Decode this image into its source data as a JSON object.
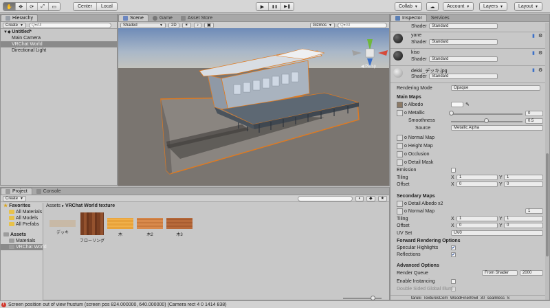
{
  "toolbar": {
    "tools": [
      "✋",
      "✥",
      "⟳",
      "⤢",
      "▭"
    ],
    "pivot_label": "Center",
    "space_label": "Local",
    "play_icons": [
      "▶",
      "❚❚",
      "▶❚"
    ],
    "collab_label": "Collab",
    "account_label": "Account",
    "layers_label": "Layers",
    "layout_label": "Layout",
    "cloud_icon": "☁"
  },
  "hierarchy": {
    "tab": "Hierarchy",
    "create": "Create",
    "search_placeholder": "Q▾All",
    "scene": "Untitled*",
    "items": [
      "Main Camera",
      "VRChat World",
      "Directional Light"
    ]
  },
  "scene": {
    "tabs": [
      "Scene",
      "Game",
      "Asset Store"
    ],
    "shading": "Shaded",
    "mode_2d": "2D",
    "gizmos": "Gizmos",
    "search_placeholder": "Q▾All",
    "persp": "◀ Persp"
  },
  "project": {
    "tabs": [
      "Project",
      "Console"
    ],
    "create": "Create",
    "favorites_label": "Favorites",
    "favorites": [
      "All Materials",
      "All Models",
      "All Prefabs"
    ],
    "assets_label": "Assets",
    "folders": [
      "Materials",
      "VRChat World"
    ],
    "breadcrumb_root": "Assets",
    "breadcrumb_sep": "▸",
    "breadcrumb_leaf": "VRChat World texture",
    "assets": [
      {
        "label": "デッキ",
        "color": "#c8b9a6"
      },
      {
        "label": "フローリング",
        "color": "#8b4a2a"
      },
      {
        "label": "木",
        "color": "#e8a23a"
      },
      {
        "label": "木2",
        "color": "#d98a4c"
      },
      {
        "label": "木3",
        "color": "#b86a3a"
      }
    ]
  },
  "inspector": {
    "tabs": [
      "Inspector",
      "Services"
    ],
    "materials": [
      {
        "name": "yane",
        "shader_label": "Shader",
        "shader": "Standard"
      },
      {
        "name": "kiso",
        "shader_label": "Shader",
        "shader": "Standard"
      },
      {
        "name": "dekki_デッキ.jpg",
        "shader_label": "Shader",
        "shader": "Standard"
      }
    ],
    "top_shader_label": "Shader",
    "top_shader": "Standard",
    "rendering_mode_label": "Rendering Mode",
    "rendering_mode": "Opaque",
    "main_maps": "Main Maps",
    "albedo": "o Albedo",
    "metallic": "o Metallic",
    "metallic_value": "0",
    "smoothness": "Smoothness",
    "smoothness_value": "0.5",
    "smoothness_fraction": 0.5,
    "source_label": "Source",
    "source": "Metallic Alpha",
    "normal_map": "o Normal Map",
    "height_map": "o Height Map",
    "occlusion": "o Occlusion",
    "detail_mask": "o Detail Mask",
    "emission": "Emission",
    "tiling": "Tiling",
    "offset": "Offset",
    "x": "X",
    "y": "Y",
    "tiling_x": "1",
    "tiling_y": "1",
    "offset_x": "0",
    "offset_y": "0",
    "secondary_maps": "Secondary Maps",
    "detail_albedo": "o Detail Albedo x2",
    "normal_map2": "o Normal Map",
    "normal_map2_value": "1",
    "tiling2_x": "1",
    "tiling2_y": "1",
    "offset2_x": "0",
    "offset2_y": "0",
    "uv_set_label": "UV Set",
    "uv_set": "UV0",
    "forward_options": "Forward Rendering Options",
    "specular_highlights": "Specular Highlights",
    "reflections": "Reflections",
    "advanced_options": "Advanced Options",
    "render_queue_label": "Render Queue",
    "render_queue_mode": "From Shader",
    "render_queue_value": "2000",
    "enable_instancing": "Enable Instancing",
    "double_sided_gi": "Double Sided Global Illumi",
    "footer_text": "taruki_TexturesCom_WoodFine0058_30_seamless_S",
    "check": "✔"
  },
  "status": {
    "error_icon": "!",
    "message": "Screen position out of view frustum (screen pos 824.000000, 640.000000) (Camera rect 4 0 1414 838)"
  }
}
